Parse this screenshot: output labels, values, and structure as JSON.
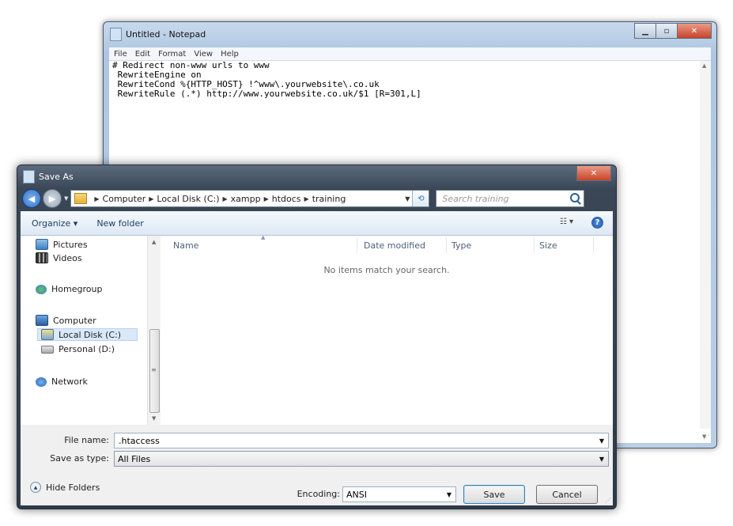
{
  "notepad": {
    "title": "Untitled - Notepad",
    "menu": [
      "File",
      "Edit",
      "Format",
      "View",
      "Help"
    ],
    "text": "# Redirect non-www urls to www\n RewriteEngine on\n RewriteCond %{HTTP_HOST} !^www\\.yourwebsite\\.co.uk\n RewriteRule (.*) http://www.yourwebsite.co.uk/$1 [R=301,L]"
  },
  "dialog": {
    "title": "Save As",
    "breadcrumb": [
      "Computer",
      "Local Disk (C:)",
      "xampp",
      "htdocs",
      "training"
    ],
    "search_placeholder": "Search training",
    "toolbar": {
      "organize": "Organize ▾",
      "new_folder": "New folder",
      "view": "☷ ▾",
      "help": "?"
    },
    "nav": {
      "pictures": "Pictures",
      "videos": "Videos",
      "homegroup": "Homegroup",
      "computer": "Computer",
      "local_disk": "Local Disk (C:)",
      "personal": "Personal (D:)",
      "network": "Network"
    },
    "columns": {
      "name": "Name",
      "date_modified": "Date modified",
      "type": "Type",
      "size": "Size"
    },
    "empty_message": "No items match your search.",
    "file_name_label": "File name:",
    "file_name_value": ".htaccess",
    "save_as_type_label": "Save as type:",
    "save_as_type_value": "All Files",
    "hide_folders": "Hide Folders",
    "encoding_label": "Encoding:",
    "encoding_value": "ANSI",
    "save": "Save",
    "cancel": "Cancel"
  },
  "colors": {
    "selection": "#d9e9f9",
    "close_button": "#c9432a",
    "dialog_frame": "#2e3a48"
  }
}
